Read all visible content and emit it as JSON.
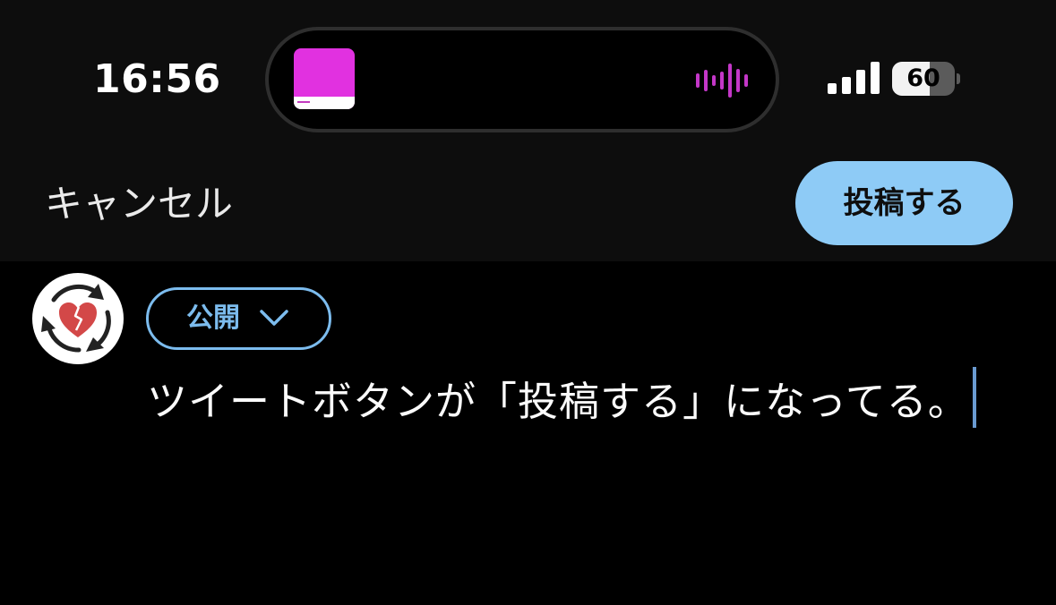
{
  "status_bar": {
    "time": "16:56",
    "battery_level": "60",
    "battery_fraction": 0.6
  },
  "now_playing": {
    "album_art_color": "#e131e0",
    "waveform_color": "#c437c8"
  },
  "composer": {
    "cancel_label": "キャンセル",
    "post_label": "投稿する",
    "audience_label": "公開",
    "tweet_text": "ツイートボタンが「投稿する」になってる。"
  },
  "colors": {
    "accent": "#8ecbf6",
    "link": "#7cbcee",
    "background": "#000000"
  }
}
